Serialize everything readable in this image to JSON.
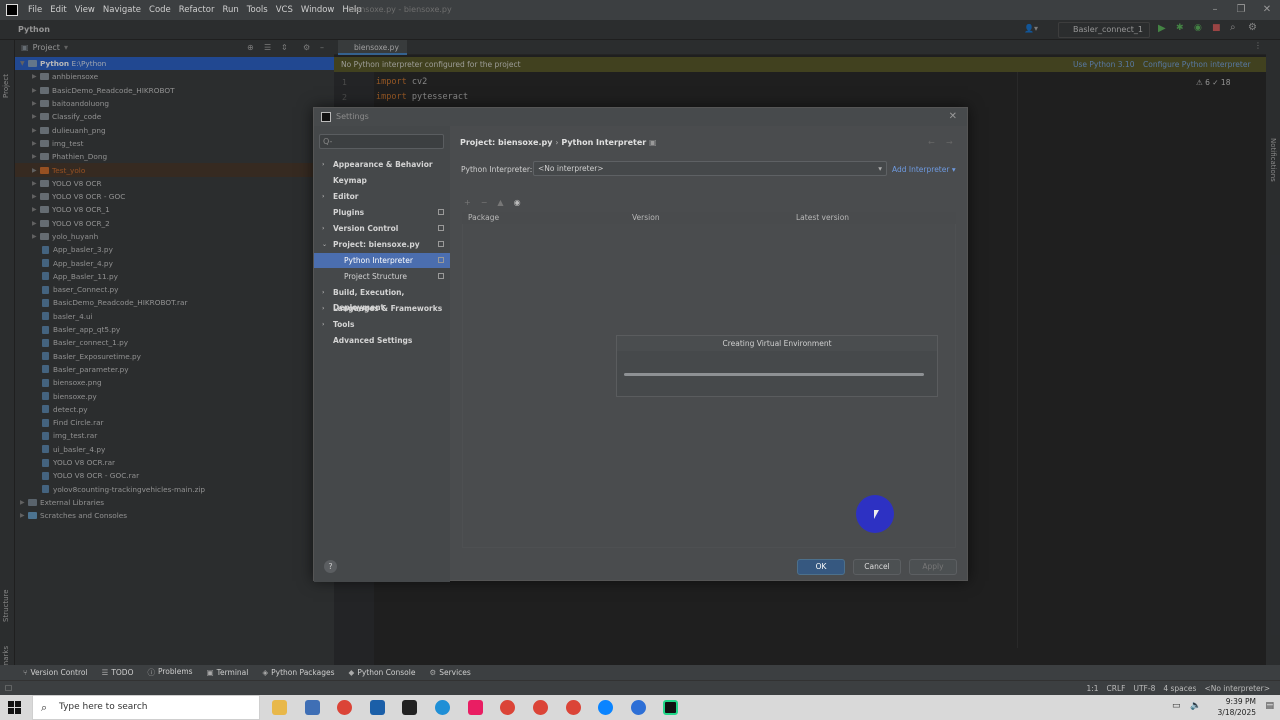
{
  "window": {
    "menu": [
      "File",
      "Edit",
      "View",
      "Navigate",
      "Code",
      "Refactor",
      "Run",
      "Tools",
      "VCS",
      "Window",
      "Help"
    ],
    "title": "biensoxe.py - biensoxe.py"
  },
  "toolbar": {
    "breadcrumb": "Python",
    "run_config": "Basler_connect_1"
  },
  "stripe": {
    "project": "Project",
    "structure": "Structure",
    "bookmarks": "Bookmarks"
  },
  "project": {
    "header": "Project",
    "root_name": "Python",
    "root_path": "E:\\Python",
    "items": [
      {
        "name": "anhbiensoxe",
        "type": "folder"
      },
      {
        "name": "BasicDemo_Readcode_HIKROBOT",
        "type": "folder"
      },
      {
        "name": "baitoandoluong",
        "type": "folder"
      },
      {
        "name": "Classify_code",
        "type": "folder"
      },
      {
        "name": "dulieuanh_png",
        "type": "folder"
      },
      {
        "name": "img_test",
        "type": "folder"
      },
      {
        "name": "Phathien_Dong",
        "type": "folder"
      },
      {
        "name": "Test_yolo",
        "type": "folder-hl"
      },
      {
        "name": "YOLO V8 OCR",
        "type": "folder"
      },
      {
        "name": "YOLO V8 OCR - GOC",
        "type": "folder"
      },
      {
        "name": "YOLO V8 OCR_1",
        "type": "folder"
      },
      {
        "name": "YOLO V8 OCR_2",
        "type": "folder"
      },
      {
        "name": "yolo_huyanh",
        "type": "folder"
      },
      {
        "name": "App_basler_3.py",
        "type": "file"
      },
      {
        "name": "App_basler_4.py",
        "type": "file"
      },
      {
        "name": "App_Basler_11.py",
        "type": "file"
      },
      {
        "name": "baser_Connect.py",
        "type": "file"
      },
      {
        "name": "BasicDemo_Readcode_HIKROBOT.rar",
        "type": "file"
      },
      {
        "name": "basler_4.ui",
        "type": "file"
      },
      {
        "name": "Basler_app_qt5.py",
        "type": "file"
      },
      {
        "name": "Basler_connect_1.py",
        "type": "file"
      },
      {
        "name": "Basler_Exposuretime.py",
        "type": "file"
      },
      {
        "name": "Basler_parameter.py",
        "type": "file"
      },
      {
        "name": "biensoxe.png",
        "type": "file"
      },
      {
        "name": "biensoxe.py",
        "type": "file"
      },
      {
        "name": "detect.py",
        "type": "file"
      },
      {
        "name": "Find Circle.rar",
        "type": "file"
      },
      {
        "name": "img_test.rar",
        "type": "file"
      },
      {
        "name": "ui_basler_4.py",
        "type": "file"
      },
      {
        "name": "YOLO V8 OCR.rar",
        "type": "file"
      },
      {
        "name": "YOLO V8 OCR - GOC.rar",
        "type": "file"
      },
      {
        "name": "yolov8counting-trackingvehicles-main.zip",
        "type": "file"
      }
    ],
    "external": "External Libraries",
    "scratches": "Scratches and Consoles"
  },
  "editor": {
    "tab": "biensoxe.py",
    "banner": "No Python interpreter configured for the project",
    "use_python": "Use Python 3.10",
    "configure": "Configure Python interpreter",
    "inspections": "⚠ 6  ✓ 18",
    "lines": [
      {
        "n": "1",
        "kw": "import",
        "rest": " cv2"
      },
      {
        "n": "2",
        "kw": "import",
        "rest": " pytesseract"
      }
    ]
  },
  "dialog": {
    "title": "Settings",
    "search_placeholder": "Q-",
    "nav": [
      {
        "label": "Appearance & Behavior",
        "arrow": "›",
        "sub": false,
        "mark": false
      },
      {
        "label": "Keymap",
        "arrow": "",
        "sub": false,
        "mark": false
      },
      {
        "label": "Editor",
        "arrow": "›",
        "sub": false,
        "mark": false
      },
      {
        "label": "Plugins",
        "arrow": "",
        "sub": false,
        "mark": true
      },
      {
        "label": "Version Control",
        "arrow": "›",
        "sub": false,
        "mark": true
      },
      {
        "label": "Project: biensoxe.py",
        "arrow": "⌄",
        "sub": false,
        "mark": true
      },
      {
        "label": "Python Interpreter",
        "arrow": "",
        "sub": true,
        "mark": true,
        "selected": true
      },
      {
        "label": "Project Structure",
        "arrow": "",
        "sub": true,
        "mark": true
      },
      {
        "label": "Build, Execution, Deployment",
        "arrow": "›",
        "sub": false,
        "mark": false
      },
      {
        "label": "Languages & Frameworks",
        "arrow": "›",
        "sub": false,
        "mark": false
      },
      {
        "label": "Tools",
        "arrow": "›",
        "sub": false,
        "mark": false
      },
      {
        "label": "Advanced Settings",
        "arrow": "",
        "sub": false,
        "mark": false
      }
    ],
    "crumb_project": "Project: biensoxe.py",
    "crumb_sep": "›",
    "crumb_page": "Python Interpreter",
    "interpreter_label": "Python Interpreter:",
    "interpreter_value": "<No interpreter>",
    "add_interpreter": "Add Interpreter ▾",
    "columns": [
      "Package",
      "Version",
      "Latest version"
    ],
    "progress_title": "Creating Virtual Environment",
    "progress": 1.0,
    "ok": "OK",
    "cancel": "Cancel",
    "apply": "Apply",
    "help": "?"
  },
  "bottom_tools": [
    "Version Control",
    "TODO",
    "Problems",
    "Terminal",
    "Python Packages",
    "Python Console",
    "Services"
  ],
  "status": {
    "pos": "1:1",
    "eol": "CRLF",
    "enc": "UTF-8",
    "indent": "4 spaces",
    "interp": "<No interpreter>"
  },
  "taskbar": {
    "search": "Type here to search",
    "time": "9:39 PM",
    "date": "3/18/2025"
  }
}
